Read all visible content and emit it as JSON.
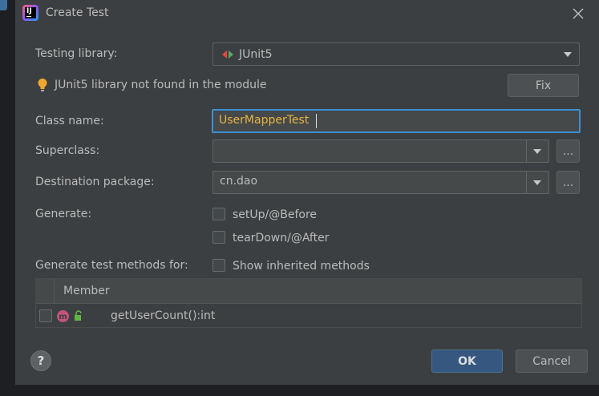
{
  "dialog": {
    "title": "Create Test"
  },
  "testing_library": {
    "label": "Testing library:",
    "value": "JUnit5"
  },
  "warning": {
    "text": "JUnit5 library not found in the module",
    "fix_label": "Fix"
  },
  "class_name": {
    "label": "Class name:",
    "value": "UserMapperTest"
  },
  "superclass": {
    "label": "Superclass:",
    "value": "",
    "browse_label": "..."
  },
  "destination": {
    "label": "Destination package:",
    "value": "cn.dao",
    "browse_label": "..."
  },
  "generate": {
    "label": "Generate:",
    "options": [
      {
        "label": "setUp/@Before",
        "checked": false
      },
      {
        "label": "tearDown/@After",
        "checked": false
      }
    ]
  },
  "methods": {
    "label": "Generate test methods for:",
    "show_inherited_label": "Show inherited methods",
    "column_header": "Member",
    "rows": [
      {
        "name": "getUserCount():int",
        "checked": false
      }
    ]
  },
  "buttons": {
    "help_label": "?",
    "ok_label": "OK",
    "cancel_label": "Cancel"
  },
  "colors": {
    "dialog_bg": "#3c3f41",
    "accent_focus": "#3d8fd1",
    "class_name_text": "#e8b341",
    "primary_button": "#365880",
    "warning_bulb": "#f0a732"
  },
  "icons": [
    "intellij-app-icon",
    "close-icon",
    "junit-arrows-icon",
    "lightbulb-icon",
    "chevron-down-icon",
    "method-icon",
    "unlocked-icon",
    "help-icon"
  ]
}
